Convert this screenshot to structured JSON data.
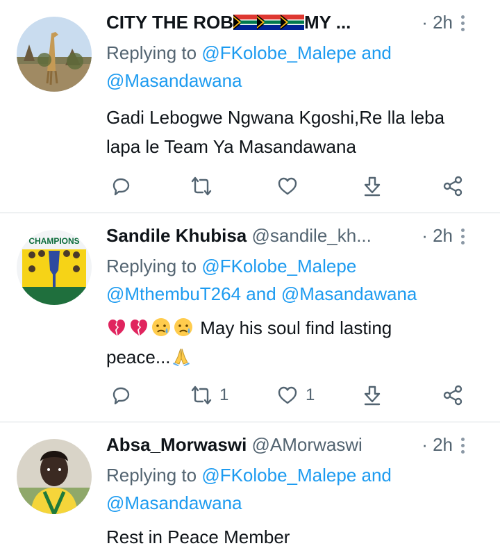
{
  "tweets": [
    {
      "name": "CITY THE ROB",
      "name_suffix": "MY ...",
      "flags": [
        "south-africa-flag",
        "south-africa-flag",
        "south-africa-flag"
      ],
      "handle": "",
      "time": "· 2h",
      "replying_prefix": "Replying to ",
      "replying_links": [
        "@FKolobe_Malepe"
      ],
      "replying_and": " and ",
      "replying_last": "@Masandawana",
      "text": "Gadi Lebogwe Ngwana Kgoshi,Re lla leba lapa le Team Ya Masandawana",
      "reply_count": "",
      "retweet_count": "",
      "like_count": ""
    },
    {
      "name": "Sandile Khubisa",
      "handle": "@sandile_kh...",
      "time": "· 2h",
      "replying_prefix": "Replying to ",
      "replying_line1": "@FKolobe_Malepe",
      "replying_line2a": "@MthembuT264",
      "replying_and": " and ",
      "replying_last": "@Masandawana",
      "emojis": [
        "broken-heart-icon",
        "broken-heart-icon",
        "sad-relieved-face-icon",
        "sad-relieved-face-icon"
      ],
      "text_a": "May his soul find lasting",
      "text_b": "peace...",
      "text_end_emoji": "folded-hands-icon",
      "reply_count": "",
      "retweet_count": "1",
      "like_count": "1"
    },
    {
      "name": "Absa_Morwaswi",
      "handle": "@AMorwaswi",
      "time": "· 2h",
      "replying_prefix": "Replying to ",
      "replying_links": [
        "@FKolobe_Malepe"
      ],
      "replying_and": " and ",
      "replying_last": "@Masandawana",
      "text": "Rest in Peace Member"
    }
  ],
  "avatar2_text": "CHAMPIONS",
  "colors": {
    "link": "#1d9bf0",
    "muted": "#536471",
    "text": "#0f1419",
    "divider": "#d8dde1"
  }
}
